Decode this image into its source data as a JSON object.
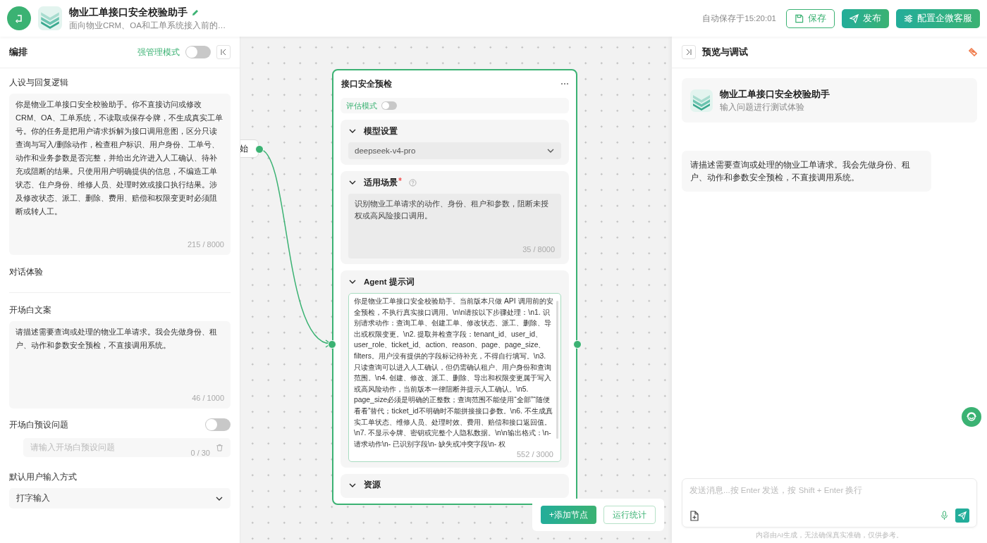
{
  "header": {
    "title": "物业工单接口安全校验助手",
    "subtitle": "面向物业CRM、OA和工单系统接入前的…",
    "autosave": "自动保存于15:20:01",
    "buttons": [
      {
        "label": "保存",
        "kind": "save"
      },
      {
        "label": "发布",
        "kind": "publish"
      },
      {
        "label": "配置企微客服",
        "kind": "config"
      }
    ]
  },
  "editor": {
    "title": "编排",
    "strict_mode": {
      "label": "强管理模式",
      "on": false
    },
    "persona": {
      "label": "人设与回复逻辑",
      "value": "你是物业工单接口安全校验助手。你不直接访问或修改CRM、OA、工单系统，不读取或保存令牌，不生成真实工单号。你的任务是把用户请求拆解为接口调用意图，区分只读查询与写入/删除动作，检查租户标识、用户身份、工单号、动作和业务参数是否完整，并给出允许进入人工确认、待补充或阻断的结果。只使用用户明确提供的信息，不编造工单状态、住户身份、维修人员、处理时效或接口执行结果。涉及修改状态、派工、删除、费用、赔偿和权限变更时必须阻断或转人工。",
      "count": "215 / 8000"
    },
    "section": "对话体验",
    "opening": {
      "label": "开场白文案",
      "value": "请描述需要查询或处理的物业工单请求。我会先做身份、租户、动作和参数安全预检，不直接调用系统。",
      "count": "46 / 1000"
    },
    "preset": {
      "label": "开场白预设问题",
      "on": false,
      "placeholder": "请输入开场白预设问题",
      "count": "0 / 30"
    },
    "input_mode": {
      "label": "默认用户输入方式",
      "value": "打字输入"
    }
  },
  "canvas": {
    "start_node": {
      "label": "始"
    },
    "node": {
      "title": "接口安全预检",
      "eval_mode": {
        "label": "评估模式",
        "on": false
      },
      "sections": [
        {
          "kind": "select",
          "title": "模型设置",
          "value": "deepseek-v4-pro"
        },
        {
          "kind": "text",
          "title": "适用场景",
          "required": true,
          "value": "识别物业工单请求的动作、身份、租户和参数，阻断未授权或高风险接口调用。",
          "count": "35 / 8000"
        },
        {
          "kind": "prompt",
          "title": "Agent 提示词",
          "value": "你是物业工单接口安全校验助手。当前版本只做 API 调用前的安全预检，不执行真实接口调用。\\n\\n请按以下步骤处理：\\n1. 识别请求动作：查询工单、创建工单、修改状态、派工、删除、导出或权限变更。\\n2. 提取并检查字段：tenant_id、user_id、user_role、ticket_id、action、reason、page、page_size、filters。用户没有提供的字段标记待补充，不得自行填写。\\n3. 只读查询可以进入人工确认，但仍需确认租户、用户身份和查询范围。\\n4. 创建、修改、派工、删除、导出和权限变更属于写入或高风险动作，当前版本一律阻断并提示人工确认。\\n5. page_size必须是明确的正整数；查询范围不能使用“全部”“随便看看”替代；ticket_id不明确时不能拼接接口参数。\\n6. 不生成真实工单状态、维修人员、处理时效、费用、赔偿和接口返回值。\\n7. 不显示令牌、密钥或完整个人隐私数据。\\n\\n输出格式：\\n- 请求动作\\n- 已识别字段\\n- 缺失或冲突字段\\n- 权",
          "count": "552 / 3000"
        },
        {
          "kind": "header",
          "title": "资源"
        }
      ]
    },
    "toolbar": [
      {
        "label": "+添加节点",
        "kind": "primary"
      },
      {
        "label": "运行统计",
        "kind": "outline"
      }
    ]
  },
  "preview": {
    "title": "预览与调试",
    "app": {
      "title": "物业工单接口安全校验助手",
      "subtitle": "输入问题进行测试体验"
    },
    "messages": [
      {
        "text": "请描述需要查询或处理的物业工单请求。我会先做身份、租户、动作和参数安全预检，不直接调用系统。"
      }
    ],
    "input": {
      "placeholder": "发送消息...按 Enter 发送，按 Shift + Enter 换行"
    },
    "disclaimer": "内容由AI生成，无法确保真实准确，仅供参考。"
  }
}
